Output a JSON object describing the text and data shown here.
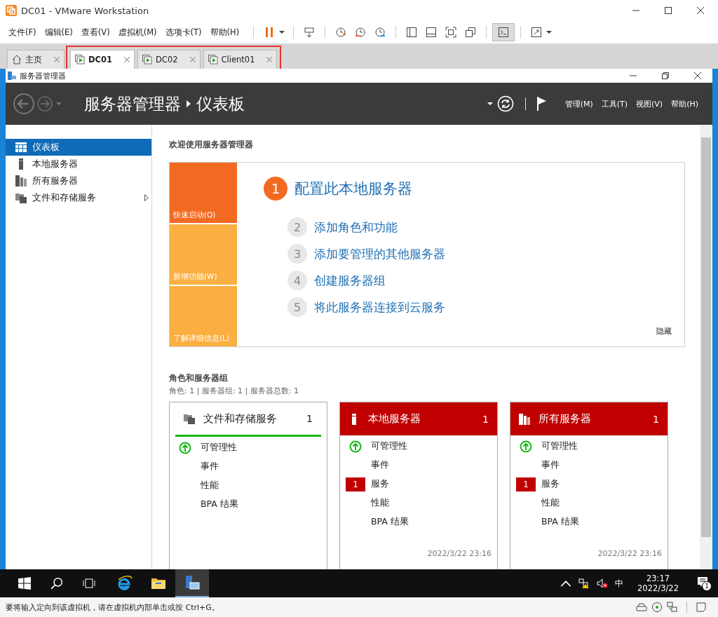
{
  "window": {
    "title": "DC01 - VMware Workstation"
  },
  "menu": [
    "文件(F)",
    "编辑(E)",
    "查看(V)",
    "虚拟机(M)",
    "选项卡(T)",
    "帮助(H)"
  ],
  "tabs": [
    {
      "label": "主页",
      "kind": "home",
      "selected": false
    },
    {
      "label": "DC01",
      "kind": "vm",
      "selected": true
    },
    {
      "label": "DC02",
      "kind": "vm",
      "selected": false
    },
    {
      "label": "Client01",
      "kind": "vm",
      "selected": false
    }
  ],
  "server_manager": {
    "title": "服务器管理器",
    "breadcrumb": [
      "服务器管理器",
      "仪表板"
    ],
    "menu": [
      "管理(M)",
      "工具(T)",
      "视图(V)",
      "帮助(H)"
    ]
  },
  "sidebar": {
    "items": [
      {
        "label": "仪表板",
        "kind": "dashboard",
        "selected": true,
        "expandable": false
      },
      {
        "label": "本地服务器",
        "kind": "server",
        "selected": false,
        "expandable": false
      },
      {
        "label": "所有服务器",
        "kind": "servers",
        "selected": false,
        "expandable": false
      },
      {
        "label": "文件和存储服务",
        "kind": "files",
        "selected": false,
        "expandable": true
      }
    ]
  },
  "welcome": {
    "heading": "欢迎使用服务器管理器",
    "tiles": [
      {
        "label": "快速启动(Q)",
        "selected": true
      },
      {
        "label": "新增功能(W)",
        "selected": false
      },
      {
        "label": "了解详细信息(L)",
        "selected": false
      }
    ],
    "steps": [
      {
        "number": "1",
        "label": "配置此本地服务器",
        "kind": "primary"
      },
      {
        "number": "2",
        "label": "添加角色和功能",
        "kind": "secondary"
      },
      {
        "number": "3",
        "label": "添加要管理的其他服务器",
        "kind": "secondary"
      },
      {
        "number": "4",
        "label": "创建服务器组",
        "kind": "secondary"
      },
      {
        "number": "5",
        "label": "将此服务器连接到云服务",
        "kind": "secondary"
      }
    ],
    "hide": "隐藏"
  },
  "roles": {
    "heading": "角色和服务器组",
    "summary": "角色: 1 | 服务器组: 1 | 服务器总数: 1",
    "cards": [
      {
        "title": "文件和存储服务",
        "count": "1",
        "kind": "files",
        "alert": false,
        "rows": [
          {
            "label": "可管理性",
            "healthy": true
          },
          {
            "label": "事件"
          },
          {
            "label": "性能"
          },
          {
            "label": "BPA 结果"
          }
        ]
      },
      {
        "title": "本地服务器",
        "count": "1",
        "kind": "server",
        "alert": true,
        "rows": [
          {
            "label": "可管理性",
            "healthy": true
          },
          {
            "label": "事件"
          },
          {
            "label": "服务",
            "badge": "1"
          },
          {
            "label": "性能"
          },
          {
            "label": "BPA 结果"
          }
        ],
        "timestamp": "2022/3/22 23:16"
      },
      {
        "title": "所有服务器",
        "count": "1",
        "kind": "servers",
        "alert": true,
        "rows": [
          {
            "label": "可管理性",
            "healthy": true
          },
          {
            "label": "事件"
          },
          {
            "label": "服务",
            "badge": "1"
          },
          {
            "label": "性能"
          },
          {
            "label": "BPA 结果"
          }
        ],
        "timestamp": "2022/3/22 23:16"
      }
    ]
  },
  "taskbar": {
    "ime": "中",
    "time": "23:17",
    "date": "2022/3/22",
    "notifications": "1"
  },
  "status_bar": {
    "text": "要将输入定向到该虚拟机，请在虚拟机内部单击或按 Ctrl+G。"
  }
}
